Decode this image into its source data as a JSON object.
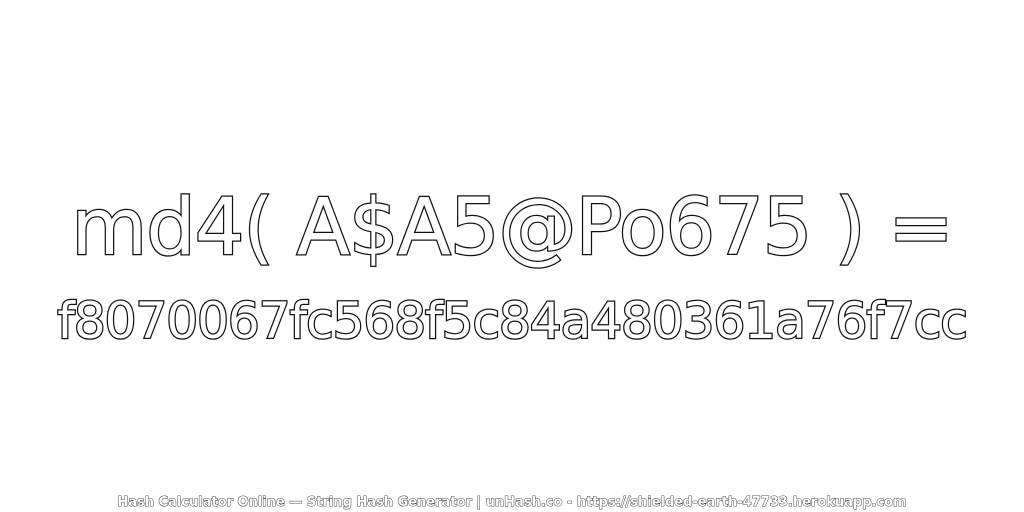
{
  "hash": {
    "expression": "md4( A$A5@Po675 ) =",
    "digest": "f8070067fc568f5c84a480361a76f7cc"
  },
  "footer": {
    "credit": "Hash Calculator Online — String Hash Generator | unHash.co - https://shielded-earth-47733.herokuapp.com"
  },
  "colors": {
    "text_fill": "#ffffff",
    "text_outline": "#111111",
    "background": "#ffffff"
  }
}
